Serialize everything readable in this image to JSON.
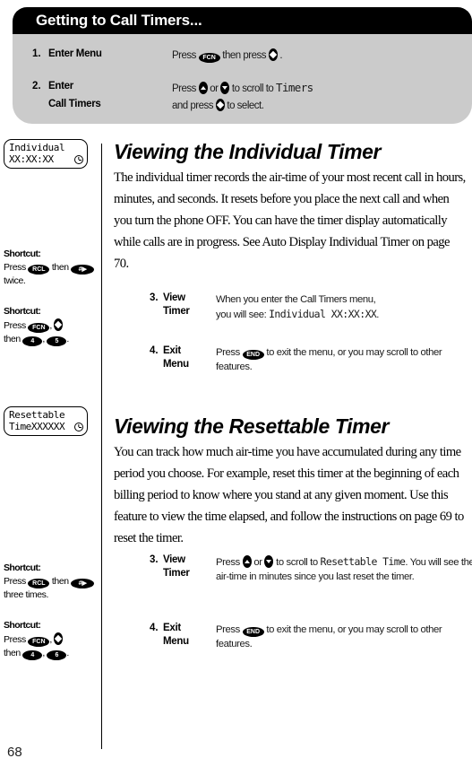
{
  "callout": {
    "title": "Getting to Call Timers...",
    "steps": [
      {
        "num": "1.",
        "name": "Enter Menu",
        "name2": "",
        "desc_parts": [
          "Press ",
          "FCN",
          " then press ",
          "select-key",
          "."
        ]
      },
      {
        "num": "2.",
        "name": "Enter",
        "name2": "Call Timers",
        "desc_line1": [
          "Press ",
          "up-key",
          " or ",
          "down-key",
          " to scroll to ",
          "Timers"
        ],
        "desc_line2": [
          "and press ",
          "select-key",
          " to select."
        ]
      }
    ]
  },
  "sections": [
    {
      "lcd": {
        "line1": "Individual",
        "line2": "XX:XX:XX",
        "icon": "clock-icon"
      },
      "heading": "Viewing the Individual Timer",
      "body": "The individual timer records the air-time of your most recent call in hours, minutes, and seconds. It resets before you place the next call and when you turn the phone OFF. You can have the timer display automatically while calls are in progress. See Auto Display Individual Timer on page 70.",
      "steps": [
        {
          "num": "3.",
          "name": "View",
          "name2": "Timer",
          "line1": "When you enter the Call Timers menu,",
          "line2_pre": "you will see: ",
          "line2_mono": "Individual XX:XX:XX",
          "line2_post": "."
        },
        {
          "num": "4.",
          "name": "Exit",
          "name2": "Menu",
          "pre": "Press ",
          "key": "END",
          "post": " to exit the menu, or you may scroll to other features."
        }
      ],
      "shortcuts": [
        {
          "title": "Shortcut:",
          "pre": "Press ",
          "key1": "RCL",
          "mid": " then ",
          "key2": "#▶",
          "post": " twice."
        },
        {
          "title": "Shortcut:",
          "pre": "Press ",
          "key1": "FCN",
          "mid": ", ",
          "key2": "select-key",
          "mid2": " then ",
          "key3": "4",
          "mid3": ", ",
          "key4": "5",
          "post": "."
        }
      ]
    },
    {
      "lcd": {
        "line1": "Resettable",
        "line2": "TimeXXXXXX",
        "icon": "clock-icon"
      },
      "heading": "Viewing the Resettable Timer",
      "body": "You can track how much air-time you have accumulated during any time period you choose. For example, reset this timer at the beginning of each billing period to know where you stand at any given moment. Use this feature to view the time elapsed, and follow the instructions on page 69 to reset the timer.",
      "steps": [
        {
          "num": "3.",
          "name": "View",
          "name2": "Timer",
          "line1_pre": "Press ",
          "line1_key_a": "up-key",
          "line1_mid": " or ",
          "line1_key_b": "down-key",
          "line1_post": " to scroll to ",
          "line1_mono": "Resettable Time",
          "line1_end": ".",
          "line2": "You will see the air-time in minutes since you last reset the timer."
        },
        {
          "num": "4.",
          "name": "Exit",
          "name2": "Menu",
          "pre": "Press ",
          "key": "END",
          "post": " to exit the menu, or you may scroll to other features."
        }
      ],
      "shortcuts": [
        {
          "title": "Shortcut:",
          "pre": "Press ",
          "key1": "RCL",
          "mid": " then ",
          "key2": "#▶",
          "post": " three times."
        },
        {
          "title": "Shortcut:",
          "pre": "Press ",
          "key1": "FCN",
          "mid": ", ",
          "key2": "select-key",
          "mid2": " then ",
          "key3": "4",
          "mid3": ", ",
          "key4": "6",
          "post": "."
        }
      ]
    }
  ],
  "page_number": "68",
  "colors": {
    "header_bar": "#000000",
    "callout_body": "#cbcbcb",
    "text": "#000000",
    "page_background": "#ffffff"
  }
}
